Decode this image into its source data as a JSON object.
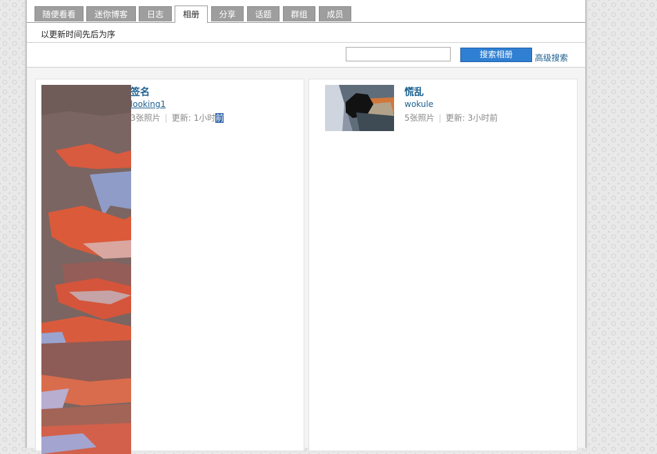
{
  "tabs": [
    {
      "label": "随便看看"
    },
    {
      "label": "迷你博客"
    },
    {
      "label": "日志"
    },
    {
      "label": "相册"
    },
    {
      "label": "分享"
    },
    {
      "label": "话题"
    },
    {
      "label": "群组"
    },
    {
      "label": "成员"
    }
  ],
  "active_tab": "相册",
  "sort_label": "以更新时间先后为序",
  "search": {
    "value": "",
    "placeholder": "",
    "button_label": "搜索相册",
    "advanced_label": "高级搜索"
  },
  "albums": [
    {
      "title": "签名",
      "owner": "looking1",
      "photos": "3张照片",
      "updated_label": "更新:",
      "updated_main": "1小时",
      "updated_highlight": "前"
    },
    {
      "title": "慌乱",
      "owner": "wokule",
      "photos": "5张照片",
      "updated_label": "更新:",
      "updated_main": "3小时前",
      "updated_highlight": ""
    }
  ],
  "colors": {
    "link": "#1a5f8f",
    "search_button": "#2f7fd3",
    "tab_inactive": "#9e9e9e",
    "highlight": "#2a62a8"
  }
}
